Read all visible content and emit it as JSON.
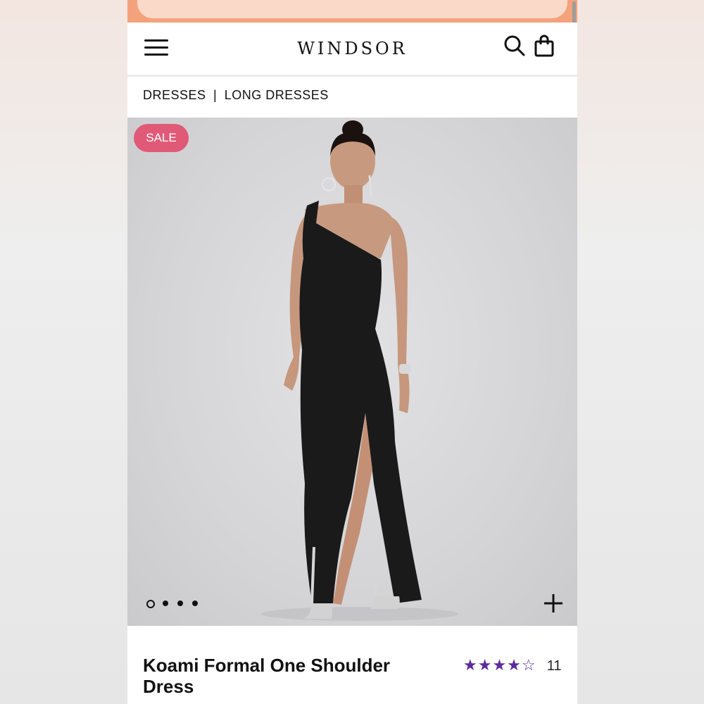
{
  "header": {
    "logo": "windsor"
  },
  "breadcrumb": {
    "category": "DRESSES",
    "separator": "|",
    "subcategory": "LONG DRESSES"
  },
  "product": {
    "badge": "SALE",
    "title": "Koami Formal One Shoulder Dress",
    "rating": 4,
    "rating_max": 5,
    "filled_stars": "★★★★",
    "empty_stars": "☆",
    "review_count": "11",
    "image_count": 4,
    "active_image": 1
  },
  "colors": {
    "promo_orange": "#f4a27c",
    "sale_pink": "#e05a78",
    "star_purple": "#5b2a9e",
    "dress_black": "#1a1a1a"
  },
  "icons": [
    "menu-icon",
    "search-icon",
    "bag-icon",
    "plus-icon"
  ]
}
